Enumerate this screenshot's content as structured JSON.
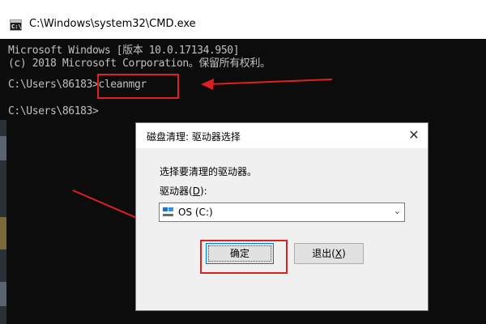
{
  "window": {
    "title": "C:\\Windows\\system32\\CMD.exe",
    "icon_text": "C:\\"
  },
  "console": {
    "lines": [
      "Microsoft Windows [版本 10.0.17134.950]",
      "(c) 2018 Microsoft Corporation。保留所有权利。",
      "C:\\Users\\86183>cleanmgr",
      "C:\\Users\\86183>"
    ]
  },
  "dialog": {
    "title": "磁盘清理: 驱动器选择",
    "close_glyph": "✕",
    "prompt": "选择要清理的驱动器。",
    "drive_label_prefix": "驱动器(",
    "drive_label_accel": "D",
    "drive_label_suffix": "):",
    "selected_drive": "OS (C:)",
    "dropdown_glyph": "⌄",
    "ok_label": "确定",
    "exit_label_prefix": "退出(",
    "exit_label_accel": "X",
    "exit_label_suffix": ")"
  },
  "colors": {
    "console_bg": "#0c0c0c",
    "console_text": "#c0c0c0",
    "highlight": "#e02020",
    "focus_border": "#0078d7"
  }
}
